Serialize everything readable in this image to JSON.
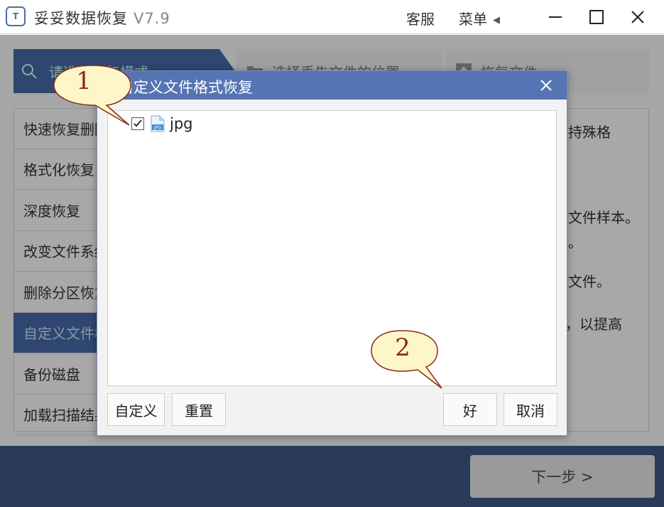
{
  "app": {
    "logo_text": "T",
    "title": "妥妥数据恢复",
    "version": "V7.9",
    "service": "客服",
    "menu": "菜单",
    "menu_arrow": "◀"
  },
  "steps": {
    "step1": "请选择恢复模式",
    "step2": "选择丢失文件的位置",
    "step3": "恢复文件"
  },
  "modes": [
    {
      "label": "快速恢复删除的文件"
    },
    {
      "label": "格式化恢复"
    },
    {
      "label": "深度恢复"
    },
    {
      "label": "改变文件系统恢复"
    },
    {
      "label": "删除分区恢复"
    },
    {
      "label": "自定义文件格式恢复"
    },
    {
      "label": "备份磁盘"
    },
    {
      "label": "加载扫描结果"
    }
  ],
  "description": {
    "line1": "持殊格",
    "line2": "文件样本。",
    "line3": "。",
    "line4": "文件。",
    "line5": "，以提高"
  },
  "next_button": "下一步 >",
  "dialog": {
    "title": "自定义文件格式恢复",
    "files": [
      {
        "name": "jpg",
        "checked": true,
        "icon_label": "JPG"
      }
    ],
    "buttons": {
      "custom": "自定义",
      "reset": "重置",
      "ok": "好",
      "cancel": "取消"
    }
  },
  "callouts": {
    "one": "1",
    "two": "2"
  },
  "colors": {
    "dialog_header": "#5574b4",
    "active_step": "#2f4670",
    "bottom_bar": "#293a5a",
    "callout_fill": "#fdf6c8",
    "callout_border": "#8b2a1a"
  }
}
